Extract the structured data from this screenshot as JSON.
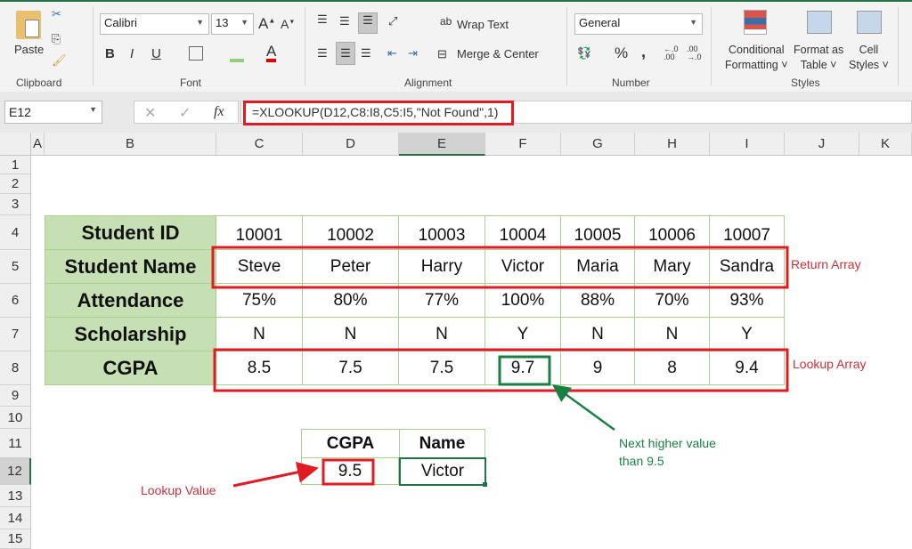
{
  "ribbon": {
    "clipboard": {
      "label": "Clipboard",
      "paste": "Paste"
    },
    "font": {
      "label": "Font",
      "name": "Calibri",
      "size": "13",
      "bold": "B",
      "italic": "I",
      "underline": "U"
    },
    "alignment": {
      "label": "Alignment",
      "wrap_text": "Wrap Text",
      "merge_center": "Merge & Center"
    },
    "number": {
      "label": "Number",
      "format": "General",
      "percent": "%",
      "comma": ","
    },
    "styles": {
      "label": "Styles",
      "conditional": [
        "Conditional",
        "Formatting"
      ],
      "format_table": [
        "Format as",
        "Table"
      ],
      "cell_styles": [
        "Cell",
        "Styles"
      ]
    }
  },
  "formula_bar": {
    "name_box": "E12",
    "fx": "fx",
    "formula": "=XLOOKUP(D12,C8:I8,C5:I5,\"Not Found\",1)"
  },
  "columns": [
    "A",
    "B",
    "C",
    "D",
    "E",
    "F",
    "G",
    "H",
    "I",
    "J",
    "K"
  ],
  "rows": [
    "1",
    "2",
    "3",
    "4",
    "5",
    "6",
    "7",
    "8",
    "9",
    "10",
    "11",
    "12",
    "13",
    "14",
    "15"
  ],
  "table": {
    "headers": [
      "Student ID",
      "Student Name",
      "Attendance",
      "Scholarship",
      "CGPA"
    ],
    "rows": [
      [
        "10001",
        "10002",
        "10003",
        "10004",
        "10005",
        "10006",
        "10007"
      ],
      [
        "Steve",
        "Peter",
        "Harry",
        "Victor",
        "Maria",
        "Mary",
        "Sandra"
      ],
      [
        "75%",
        "80%",
        "77%",
        "100%",
        "88%",
        "70%",
        "93%"
      ],
      [
        "N",
        "N",
        "N",
        "Y",
        "N",
        "N",
        "Y"
      ],
      [
        "8.5",
        "7.5",
        "7.5",
        "9.7",
        "9",
        "8",
        "9.4"
      ]
    ]
  },
  "lookup": {
    "col1": "CGPA",
    "col2": "Name",
    "value": "9.5",
    "result": "Victor"
  },
  "annotations": {
    "return_array": "Return Array",
    "lookup_array": "Lookup Array",
    "next_higher": [
      "Next higher value",
      "than 9.5"
    ],
    "lookup_value": "Lookup Value"
  },
  "colors": {
    "header_fill": "#c6e0b4",
    "highlight_red": "#e01b24",
    "highlight_green": "#1a7f45",
    "note_red": "#c8323c"
  }
}
